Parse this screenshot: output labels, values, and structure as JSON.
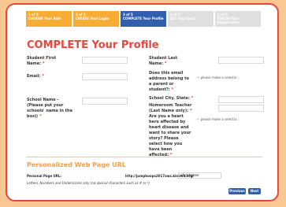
{
  "steps": [
    {
      "num": "1 of 5",
      "label": "CHOOSE Your Role",
      "state": "done"
    },
    {
      "num": "2 of 5",
      "label": "CREATE Your Login",
      "state": "done"
    },
    {
      "num": "3 of 5",
      "label": "COMPLETE Your Profile",
      "state": "active"
    },
    {
      "num": "4 of 5",
      "label": "SET Your Goal",
      "state": "todo"
    },
    {
      "num": "5 of 5",
      "label": "FINISH Your Registration",
      "state": "todo"
    }
  ],
  "title": "COMPLETE Your Profile",
  "fields": {
    "first_name": "Student First Name:",
    "last_name": "Student Last Name:",
    "email": "Email:",
    "parent_email": "Does this email address belong to a parent or student?:",
    "school_name": "School Name - (Please put your schools' name in the box):",
    "school_city": "School City, State:",
    "homeroom": "Homeroom Teacher (Last Name only):",
    "heart_question": "Are you a heart hero affected by heart disease and want to share your story? Please select how you have been affected:",
    "select_placeholder": "--- please make a selectio ;"
  },
  "personalized": {
    "heading": "Personalized Web Page URL",
    "label": "Personal Page URL:",
    "prefix": "http://jumphoops2017aws.kintera.org/",
    "value": "afgdsfgeeer",
    "help": "Letters, Numbers and Underscores only (no special characters such as # or !)"
  },
  "buttons": {
    "previous": "Previous",
    "next": "Next"
  },
  "required_mark": "*"
}
